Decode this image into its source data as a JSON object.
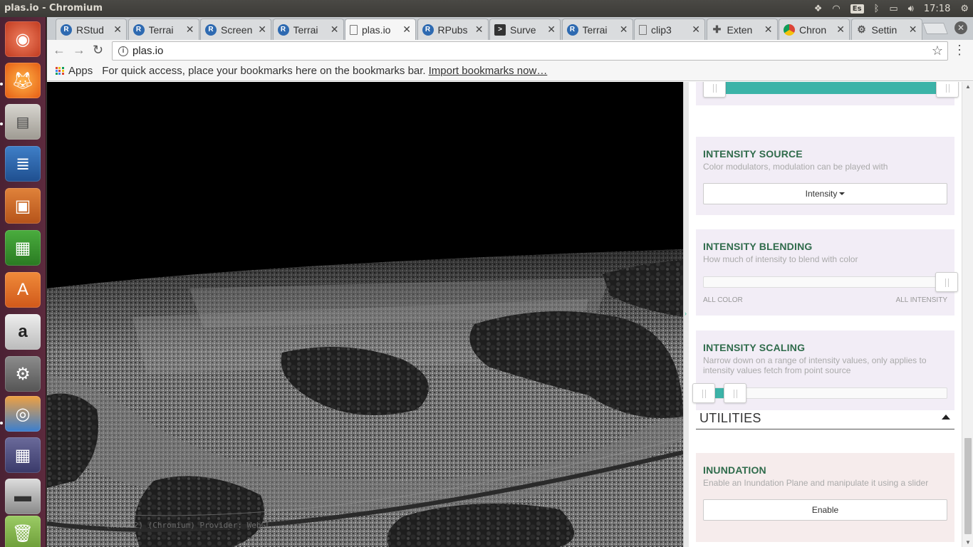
{
  "window_title": "plas.io - Chromium",
  "tray": {
    "keyboard_layout": "Es",
    "clock": "17:18"
  },
  "launcher": {
    "apps": [
      "ubuntu-dash",
      "firefox",
      "files",
      "libreoffice-writer",
      "libreoffice-impress",
      "libreoffice-calc",
      "ubuntu-software",
      "amazon",
      "system-settings",
      "software-updater",
      "chromium",
      "workspaces",
      "scanner",
      "trash"
    ]
  },
  "tabs": [
    {
      "title": "RStud",
      "icon": "r-icon"
    },
    {
      "title": "Terrai",
      "icon": "r-icon"
    },
    {
      "title": "Screen",
      "icon": "r-icon"
    },
    {
      "title": "Terrai",
      "icon": "r-icon"
    },
    {
      "title": "plas.io",
      "icon": "doc-icon",
      "active": true
    },
    {
      "title": "RPubs",
      "icon": "r-icon"
    },
    {
      "title": "Surve",
      "icon": "terminal-icon"
    },
    {
      "title": "Terrai",
      "icon": "r-icon"
    },
    {
      "title": "clip3",
      "icon": "doc-icon"
    },
    {
      "title": "Exten",
      "icon": "puzzle-icon"
    },
    {
      "title": "Chron",
      "icon": "chrome-icon"
    },
    {
      "title": "Settin",
      "icon": "gear-icon"
    }
  ],
  "address_bar": {
    "url": "plas.io"
  },
  "bookmarks_bar": {
    "apps_label": "Apps",
    "hint": "For quick access, place your bookmarks here on the bookmarks bar.",
    "import_link": "Import bookmarks now…"
  },
  "viewport": {
    "provider_text": "(WebGL2) (Chromium) Provider: WebGL"
  },
  "panel": {
    "top_range": {
      "low": 0.0,
      "high": 1.0
    },
    "intensity_source": {
      "title": "INTENSITY SOURCE",
      "description": "Color modulators, modulation can be played with",
      "selected": "Intensity"
    },
    "intensity_blending": {
      "title": "INTENSITY BLENDING",
      "description": "How much of intensity to blend with color",
      "value": 1.0,
      "min_label": "ALL COLOR",
      "max_label": "ALL INTENSITY"
    },
    "intensity_scaling": {
      "title": "INTENSITY SCALING",
      "description": "Narrow down on a range of intensity values, only applies to intensity values fetch from point source",
      "low": 0.0,
      "high": 0.13
    },
    "utilities": {
      "title": "UTILITIES"
    },
    "inundation": {
      "title": "INUNDATION",
      "description": "Enable an Inundation Plane and manipulate it using a slider",
      "button": "Enable"
    }
  },
  "colors": {
    "accent": "#3cb3a8",
    "heading": "#2f6b4b"
  }
}
